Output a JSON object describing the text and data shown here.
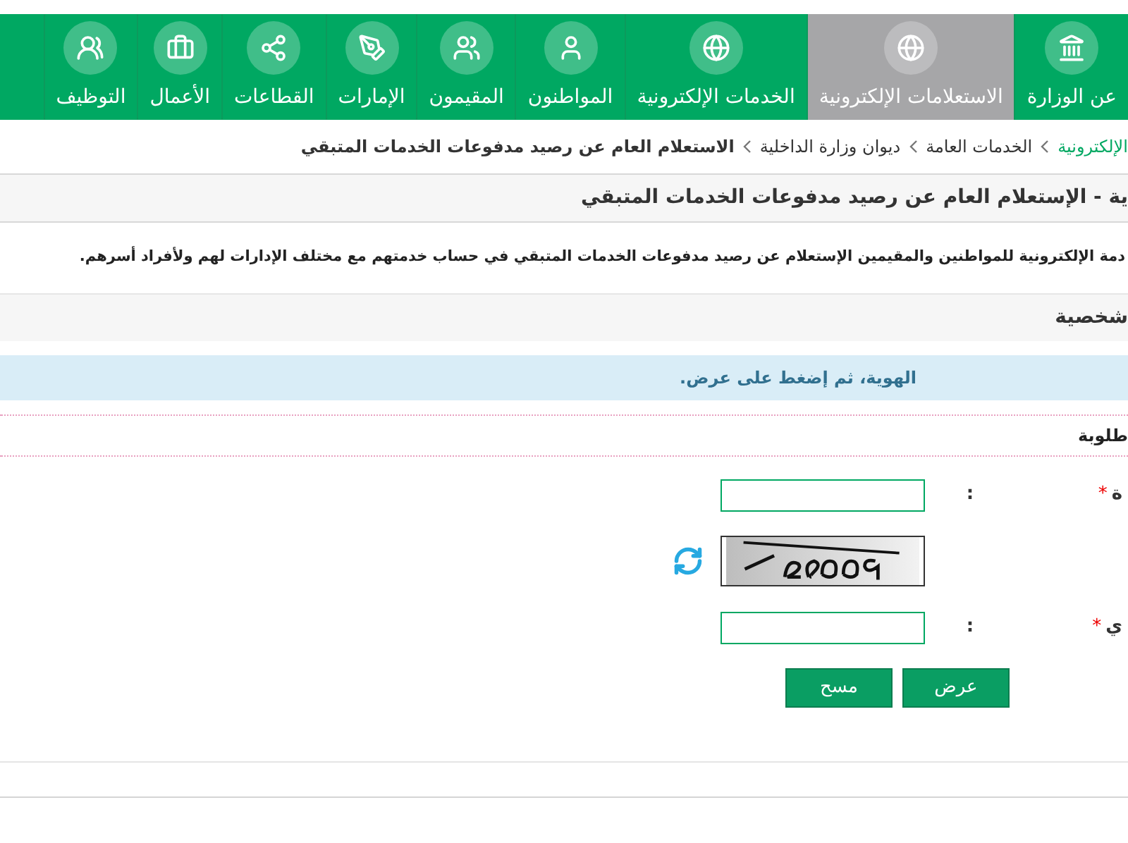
{
  "nav": {
    "items": [
      {
        "label": "عن الوزارة",
        "selected": false
      },
      {
        "label": "الاستعلامات الإلكترونية",
        "selected": true
      },
      {
        "label": "الخدمات الإلكترونية",
        "selected": false
      },
      {
        "label": "المواطنون",
        "selected": false
      },
      {
        "label": "المقيمون",
        "selected": false
      },
      {
        "label": "الإمارات",
        "selected": false
      },
      {
        "label": "القطاعات",
        "selected": false
      },
      {
        "label": "الأعمال",
        "selected": false
      },
      {
        "label": "التوظيف",
        "selected": false
      }
    ]
  },
  "breadcrumb": [
    {
      "label": "الإلكترونية",
      "kind": "link"
    },
    {
      "label": "الخدمات العامة",
      "kind": "plain"
    },
    {
      "label": "ديوان وزارة الداخلية",
      "kind": "plain"
    },
    {
      "label": "الاستعلام العام عن رصيد مدفوعات الخدمات المتبقي",
      "kind": "current"
    }
  ],
  "page_title": "ية - الإستعلام العام عن رصيد مدفوعات الخدمات المتبقي",
  "description": "دمة الإلكترونية للمواطنين والمقيمين الإستعلام عن رصيد مدفوعات الخدمات المتبقي في حساب خدمتهم مع مختلف الإدارات لهم ولأفراد أسرهم.",
  "section_title": "شخصية",
  "info_message": "الهوية، ثم إضغط على عرض.",
  "required_note": "طلوبة",
  "form": {
    "rows": [
      {
        "kind": "input",
        "label": "ة",
        "required_mark": "*",
        "colon": ":"
      },
      {
        "kind": "captcha"
      },
      {
        "kind": "input",
        "label": "ي",
        "required_mark": "*",
        "colon": ":"
      }
    ],
    "buttons": [
      {
        "label": "عرض"
      },
      {
        "label": "مسح"
      }
    ]
  }
}
